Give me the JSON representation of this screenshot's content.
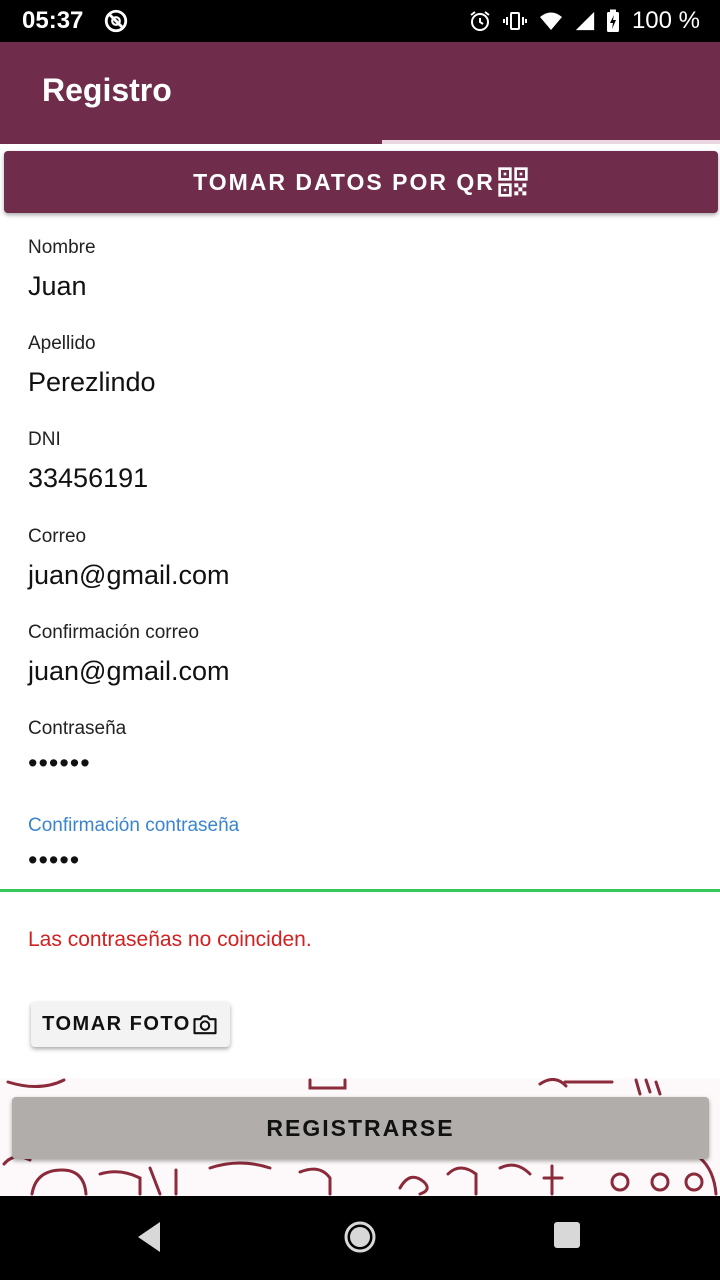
{
  "status_bar": {
    "time": "05:37",
    "left_icon": "do-not-disturb-icon",
    "right_icons": [
      "alarm-icon",
      "vibrate-icon",
      "wifi-icon",
      "signal-icon",
      "battery-charging-icon"
    ],
    "battery": "100 %"
  },
  "app_bar": {
    "title": "Registro",
    "progress_fraction": 0.53
  },
  "qr_button": {
    "label": "TOMAR DATOS POR QR",
    "icon": "qr-code-icon"
  },
  "form": {
    "fields": [
      {
        "label": "Nombre",
        "value": "Juan"
      },
      {
        "label": "Apellido",
        "value": "Perezlindo"
      },
      {
        "label": "DNI",
        "value": "33456191"
      },
      {
        "label": "Correo",
        "value": "juan@gmail.com"
      },
      {
        "label": "Confirmación correo",
        "value": "juan@gmail.com"
      },
      {
        "label": "Contraseña",
        "value": "••••••"
      },
      {
        "label": "Confirmación contraseña",
        "value": "•••••"
      }
    ],
    "error": "Las contraseñas no coinciden."
  },
  "photo_button": {
    "label": "TOMAR FOTO",
    "icon": "camera-icon"
  },
  "register_button": {
    "label": "REGISTRARSE"
  },
  "nav_bar": {
    "icons": [
      "back-icon",
      "home-icon",
      "recents-icon"
    ]
  },
  "colors": {
    "primary": "#6f2d4b",
    "focus": "#3a85d0",
    "focus_line": "#35c759",
    "error": "#d21f1f",
    "disabled_button": "#b0adab"
  }
}
